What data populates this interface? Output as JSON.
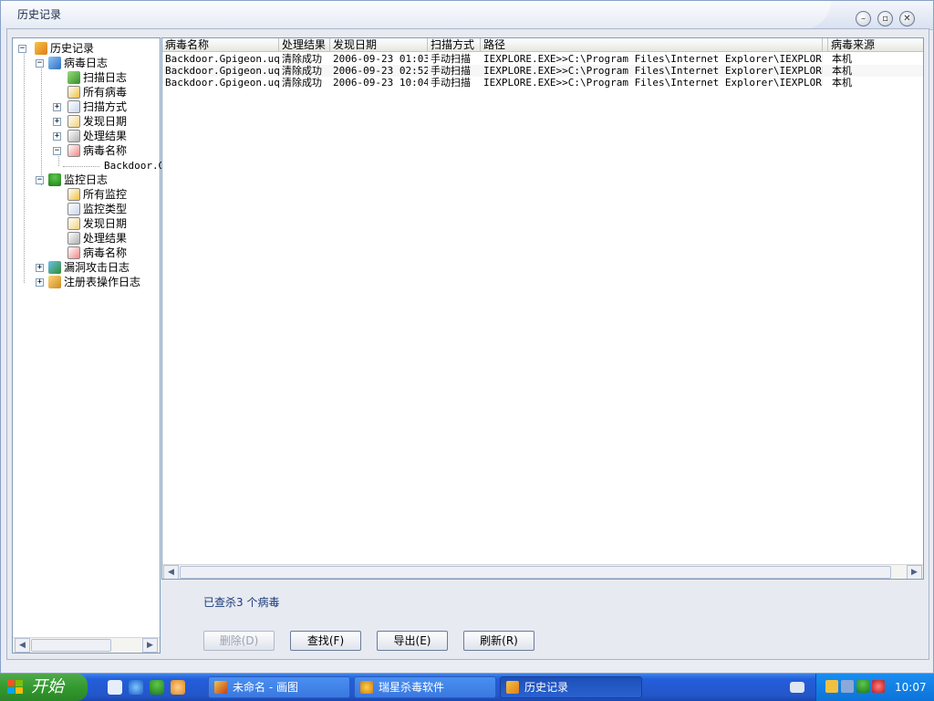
{
  "window": {
    "title": "历史记录"
  },
  "tree": {
    "root": "历史记录",
    "virus_log": "病毒日志",
    "virus_children": [
      "扫描日志",
      "所有病毒",
      "扫描方式",
      "发现日期",
      "处理结果",
      "病毒名称"
    ],
    "virus_name_child": "Backdoor.G",
    "monitor_log": "监控日志",
    "monitor_children": [
      "所有监控",
      "监控类型",
      "发现日期",
      "处理结果",
      "病毒名称"
    ],
    "exploit_log": "漏洞攻击日志",
    "registry_log": "注册表操作日志"
  },
  "list": {
    "columns": [
      "病毒名称",
      "处理结果",
      "发现日期",
      "扫描方式",
      "路径",
      "病毒来源"
    ],
    "rows": [
      {
        "name": "Backdoor.Gpigeon.uql",
        "result": "清除成功",
        "date": "2006-09-23 01:03",
        "method": "手动扫描",
        "path": "IEXPLORE.EXE>>C:\\Program Files\\Internet Explorer\\IEXPLORE.EXE",
        "source": "本机"
      },
      {
        "name": "Backdoor.Gpigeon.uql",
        "result": "清除成功",
        "date": "2006-09-23 02:52",
        "method": "手动扫描",
        "path": "IEXPLORE.EXE>>C:\\Program Files\\Internet Explorer\\IEXPLORE.EXE",
        "source": "本机"
      },
      {
        "name": "Backdoor.Gpigeon.uql",
        "result": "清除成功",
        "date": "2006-09-23 10:04",
        "method": "手动扫描",
        "path": "IEXPLORE.EXE>>C:\\Program Files\\Internet Explorer\\IEXPLORE.EXE",
        "source": "本机"
      }
    ]
  },
  "status": {
    "text": "已查杀3 个病毒"
  },
  "buttons": {
    "delete": "删除(D)",
    "find": "查找(F)",
    "export": "导出(E)",
    "refresh": "刷新(R)"
  },
  "taskbar": {
    "start": "开始",
    "tasks": [
      "未命名 - 画图",
      "瑞星杀毒软件",
      "历史记录"
    ],
    "clock": "10:07"
  }
}
